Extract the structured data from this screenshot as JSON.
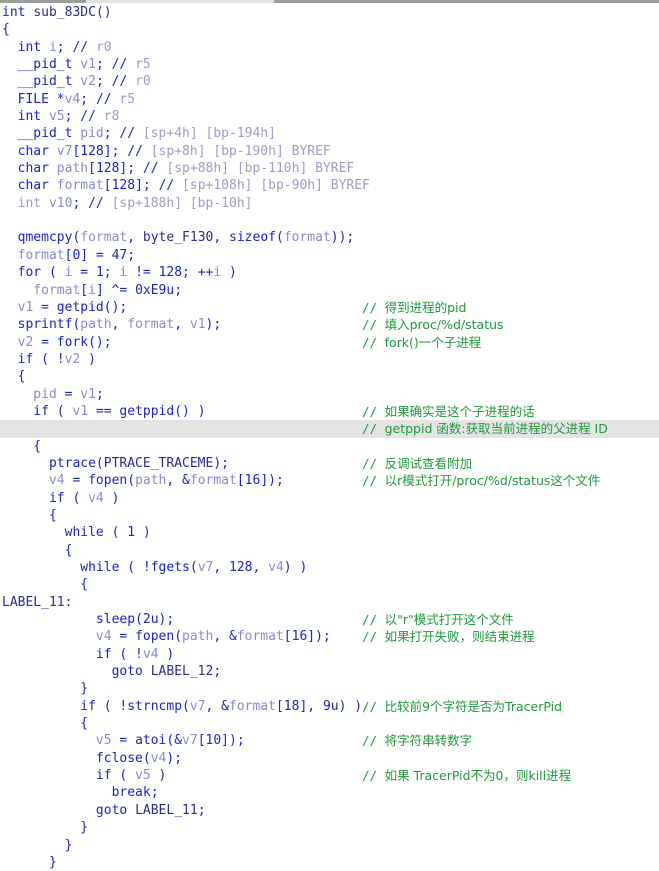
{
  "window": {
    "title": "int sub_83DC()",
    "view": "pseudocode"
  },
  "colors": {
    "background": "#ffffff",
    "keyword": "#1c24c4",
    "identifier": "#2b2b8f",
    "local_variable": "#8a8ad0",
    "comment": "#1f9a3c",
    "comment_light": "#63c26e",
    "annotation": "#9d9dc8",
    "highlight_row": "#e4e4e4"
  },
  "code": {
    "lines": [
      {
        "text": "int sub_83DC()",
        "indent": 0,
        "comment": ""
      },
      {
        "text": "{",
        "indent": 0,
        "comment": ""
      },
      {
        "text": "int i; // r0",
        "indent": 1,
        "comment": ""
      },
      {
        "text": "__pid_t v1; // r5",
        "indent": 1,
        "comment": ""
      },
      {
        "text": "__pid_t v2; // r0",
        "indent": 1,
        "comment": ""
      },
      {
        "text": "FILE *v4; // r5",
        "indent": 1,
        "comment": ""
      },
      {
        "text": "int v5; // r8",
        "indent": 1,
        "comment": ""
      },
      {
        "text": "__pid_t pid; // [sp+4h] [bp-194h]",
        "indent": 1,
        "comment": ""
      },
      {
        "text": "char v7[128]; // [sp+8h] [bp-190h] BYREF",
        "indent": 1,
        "comment": ""
      },
      {
        "text": "char path[128]; // [sp+88h] [bp-110h] BYREF",
        "indent": 1,
        "comment": ""
      },
      {
        "text": "char format[128]; // [sp+108h] [bp-90h] BYREF",
        "indent": 1,
        "comment": ""
      },
      {
        "text": "int v10; // [sp+188h] [bp-10h]",
        "indent": 1,
        "comment": ""
      },
      {
        "text": "",
        "indent": 0,
        "comment": ""
      },
      {
        "text": "qmemcpy(format, byte_F130, sizeof(format));",
        "indent": 1,
        "comment": ""
      },
      {
        "text": "format[0] = 47;",
        "indent": 1,
        "comment": ""
      },
      {
        "text": "for ( i = 1; i != 128; ++i )",
        "indent": 1,
        "comment": ""
      },
      {
        "text": "format[i] ^= 0xE9u;",
        "indent": 2,
        "comment": ""
      },
      {
        "text": "v1 = getpid();",
        "indent": 1,
        "comment": "得到进程的pid"
      },
      {
        "text": "sprintf(path, format, v1);",
        "indent": 1,
        "comment": "填入proc/%d/status"
      },
      {
        "text": "v2 = fork();",
        "indent": 1,
        "comment": "fork()一个子进程"
      },
      {
        "text": "if ( !v2 )",
        "indent": 1,
        "comment": ""
      },
      {
        "text": "{",
        "indent": 1,
        "comment": ""
      },
      {
        "text": "pid = v1;",
        "indent": 2,
        "comment": ""
      },
      {
        "text": "if ( v1 == getppid() )",
        "indent": 2,
        "comment": "如果确实是这个子进程的话"
      },
      {
        "text": "",
        "indent": 0,
        "comment": "getppid 函数:获取当前进程的父进程 ID",
        "highlight": true
      },
      {
        "text": "{",
        "indent": 2,
        "comment": ""
      },
      {
        "text": "ptrace(PTRACE_TRACEME);",
        "indent": 3,
        "comment": "反调试查看附加"
      },
      {
        "text": "v4 = fopen(path, &format[16]);",
        "indent": 3,
        "comment": "以r模式打开/proc/%d/status这个文件"
      },
      {
        "text": "if ( v4 )",
        "indent": 3,
        "comment": ""
      },
      {
        "text": "{",
        "indent": 3,
        "comment": ""
      },
      {
        "text": "while ( 1 )",
        "indent": 4,
        "comment": ""
      },
      {
        "text": "{",
        "indent": 4,
        "comment": ""
      },
      {
        "text": "while ( !fgets(v7, 128, v4) )",
        "indent": 5,
        "comment": ""
      },
      {
        "text": "{",
        "indent": 5,
        "comment": ""
      },
      {
        "text": "LABEL_11:",
        "indent": 0,
        "comment": ""
      },
      {
        "text": "sleep(2u);",
        "indent": 6,
        "comment": "以\"r\"模式打开这个文件"
      },
      {
        "text": "v4 = fopen(path, &format[16]);",
        "indent": 6,
        "comment": "如果打开失败，则结束进程"
      },
      {
        "text": "if ( !v4 )",
        "indent": 6,
        "comment": ""
      },
      {
        "text": "goto LABEL_12;",
        "indent": 7,
        "comment": ""
      },
      {
        "text": "}",
        "indent": 5,
        "comment": ""
      },
      {
        "text": "if ( !strncmp(v7, &format[18], 9u) )",
        "indent": 5,
        "comment": "比较前9个字符是否为TracerPid"
      },
      {
        "text": "{",
        "indent": 5,
        "comment": ""
      },
      {
        "text": "v5 = atoi(&v7[10]);",
        "indent": 6,
        "comment": "将字符串转数字"
      },
      {
        "text": "fclose(v4);",
        "indent": 6,
        "comment": ""
      },
      {
        "text": "if ( v5 )",
        "indent": 6,
        "comment": "如果 TracerPid不为0，则kill进程"
      },
      {
        "text": "break;",
        "indent": 7,
        "comment": ""
      },
      {
        "text": "goto LABEL_11;",
        "indent": 6,
        "comment": ""
      },
      {
        "text": "}",
        "indent": 5,
        "comment": ""
      },
      {
        "text": "}",
        "indent": 4,
        "comment": ""
      },
      {
        "text": "}",
        "indent": 3,
        "comment": ""
      }
    ],
    "comments": [
      "得到进程的pid",
      "填入proc/%d/status",
      "fork()一个子进程",
      "如果确实是这个子进程的话",
      "getppid 函数:获取当前进程的父进程 ID",
      "反调试查看附加",
      "以r模式打开/proc/%d/status这个文件",
      "以\"r\"模式打开这个文件",
      "如果打开失败，则结束进程",
      "比较前9个字符是否为TracerPid",
      "将字符串转数字",
      "如果 TracerPid不为0，则kill进程"
    ],
    "function_name": "sub_83DC",
    "labels": [
      "LABEL_11",
      "LABEL_12"
    ],
    "locals": [
      "i",
      "v1",
      "v2",
      "v4",
      "v5",
      "pid",
      "v7",
      "path",
      "format",
      "v10"
    ],
    "globals": [
      "byte_F130"
    ],
    "api_calls": [
      "qmemcpy",
      "getpid",
      "sprintf",
      "fork",
      "getppid",
      "ptrace",
      "fopen",
      "fgets",
      "sleep",
      "strncmp",
      "atoi",
      "fclose"
    ]
  }
}
